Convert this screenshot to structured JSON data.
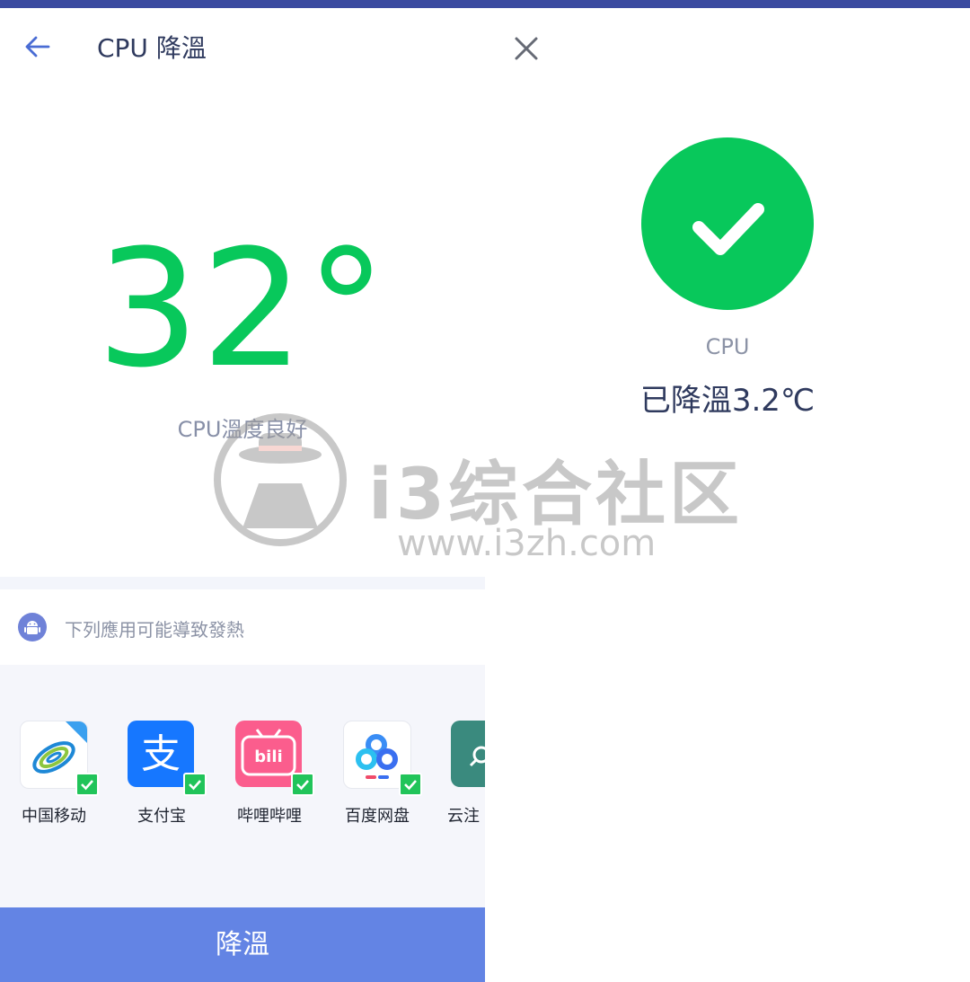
{
  "left": {
    "title": "CPU 降溫",
    "temperature": "32°",
    "temperature_status": "CPU溫度良好",
    "cause_text": "下列應用可能導致發熱",
    "apps": [
      {
        "name": "中国移动",
        "icon": "china-mobile-icon",
        "checked": true
      },
      {
        "name": "支付宝",
        "icon": "alipay-icon",
        "checked": true
      },
      {
        "name": "哔哩哔哩",
        "icon": "bilibili-icon",
        "checked": true
      },
      {
        "name": "百度网盘",
        "icon": "baidu-netdisk-icon",
        "checked": true
      },
      {
        "name": "云注",
        "icon": "cloud-app-icon",
        "checked": false
      }
    ],
    "cool_button": "降溫"
  },
  "right": {
    "label": "CPU",
    "result": "已降溫3.2℃"
  },
  "watermark": {
    "title": "i3综合社区",
    "url": "www.i3zh.com"
  },
  "colors": {
    "accent_green": "#08c85b",
    "button_blue": "#6384e4",
    "top_bar": "#3a4aa0",
    "title_text": "#2f3a5e"
  }
}
